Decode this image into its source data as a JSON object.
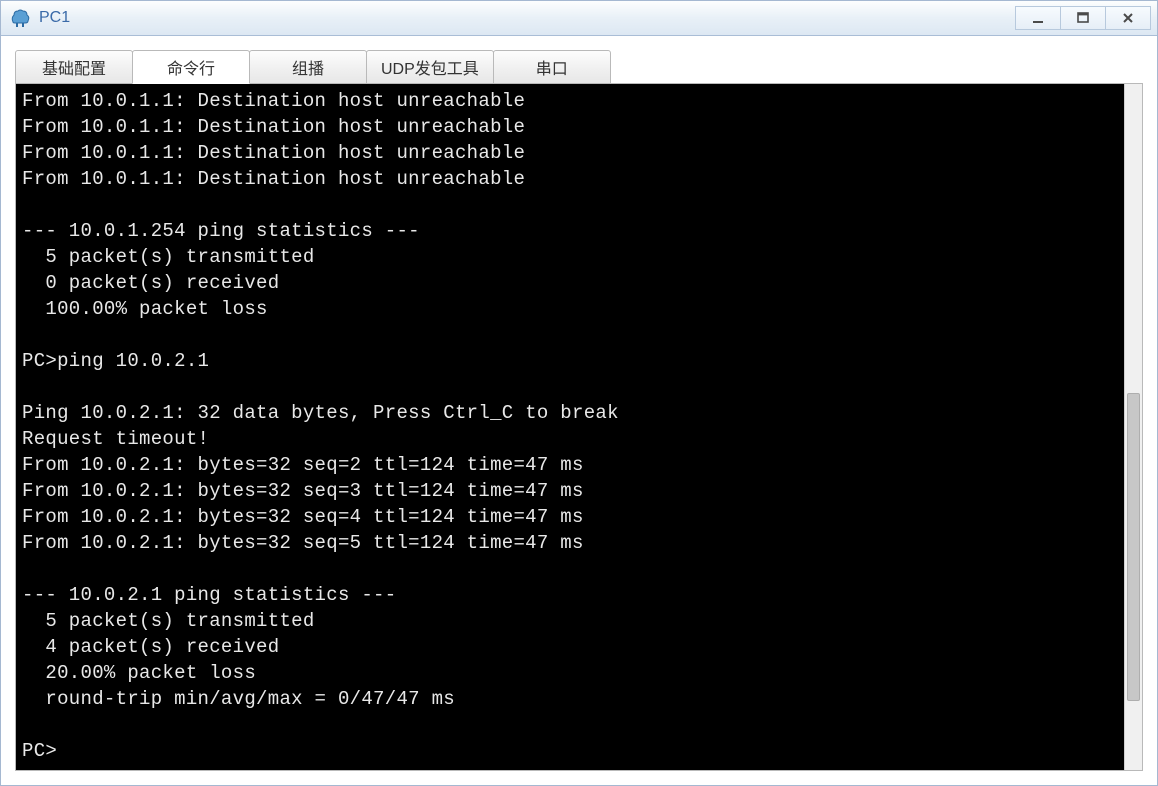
{
  "window": {
    "title": "PC1"
  },
  "tabs": [
    {
      "label": "基础配置"
    },
    {
      "label": "命令行"
    },
    {
      "label": "组播"
    },
    {
      "label": "UDP发包工具"
    },
    {
      "label": "串口"
    }
  ],
  "activeTabIndex": 1,
  "terminal": {
    "lines": [
      "From 10.0.1.1: Destination host unreachable",
      "From 10.0.1.1: Destination host unreachable",
      "From 10.0.1.1: Destination host unreachable",
      "From 10.0.1.1: Destination host unreachable",
      "",
      "--- 10.0.1.254 ping statistics ---",
      "  5 packet(s) transmitted",
      "  0 packet(s) received",
      "  100.00% packet loss",
      "",
      "PC>ping 10.0.2.1",
      "",
      "Ping 10.0.2.1: 32 data bytes, Press Ctrl_C to break",
      "Request timeout!",
      "From 10.0.2.1: bytes=32 seq=2 ttl=124 time=47 ms",
      "From 10.0.2.1: bytes=32 seq=3 ttl=124 time=47 ms",
      "From 10.0.2.1: bytes=32 seq=4 ttl=124 time=47 ms",
      "From 10.0.2.1: bytes=32 seq=5 ttl=124 time=47 ms",
      "",
      "--- 10.0.2.1 ping statistics ---",
      "  5 packet(s) transmitted",
      "  4 packet(s) received",
      "  20.00% packet loss",
      "  round-trip min/avg/max = 0/47/47 ms",
      "",
      "PC>"
    ]
  }
}
